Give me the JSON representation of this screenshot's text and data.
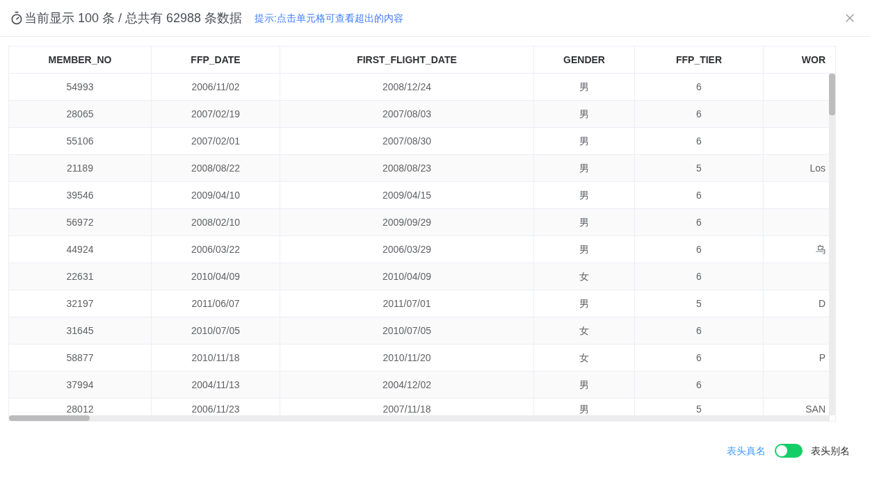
{
  "dialog": {
    "title": "当前显示 100 条 / 总共有 62988 条数据",
    "hint": "提示:点击单元格可查看超出的内容"
  },
  "table": {
    "columns": [
      "MEMBER_NO",
      "FFP_DATE",
      "FIRST_FLIGHT_DATE",
      "GENDER",
      "FFP_TIER",
      "WOR"
    ],
    "rows": [
      [
        "54993",
        "2006/11/02",
        "2008/12/24",
        "男",
        "6"
      ],
      [
        "28065",
        "2007/02/19",
        "2007/08/03",
        "男",
        "6"
      ],
      [
        "55106",
        "2007/02/01",
        "2007/08/30",
        "男",
        "6"
      ],
      [
        "21189",
        "2008/08/22",
        "2008/08/23",
        "男",
        "5",
        "Los"
      ],
      [
        "39546",
        "2009/04/10",
        "2009/04/15",
        "男",
        "6"
      ],
      [
        "56972",
        "2008/02/10",
        "2009/09/29",
        "男",
        "6"
      ],
      [
        "44924",
        "2006/03/22",
        "2006/03/29",
        "男",
        "6",
        "乌"
      ],
      [
        "22631",
        "2010/04/09",
        "2010/04/09",
        "女",
        "6"
      ],
      [
        "32197",
        "2011/06/07",
        "2011/07/01",
        "男",
        "5",
        "D"
      ],
      [
        "31645",
        "2010/07/05",
        "2010/07/05",
        "女",
        "6"
      ],
      [
        "58877",
        "2010/11/18",
        "2010/11/20",
        "女",
        "6",
        "P"
      ],
      [
        "37994",
        "2004/11/13",
        "2004/12/02",
        "男",
        "6"
      ],
      [
        "28012",
        "2006/11/23",
        "2007/11/18",
        "男",
        "5",
        "SAN"
      ]
    ]
  },
  "footer": {
    "real_name_label": "表头真名",
    "switch": {
      "on": false
    },
    "alias_label": "表头别名"
  }
}
